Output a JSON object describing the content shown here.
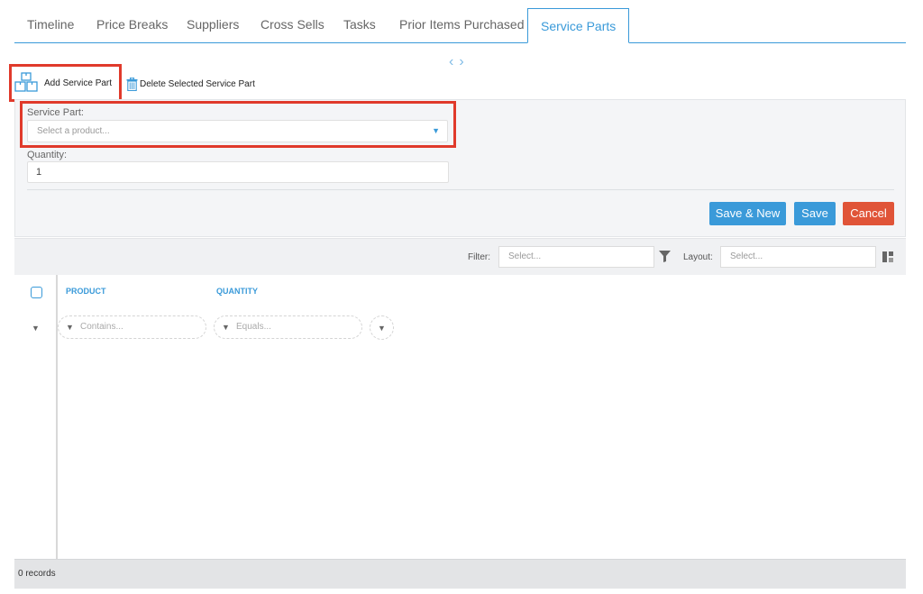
{
  "tabs": [
    {
      "label": "Timeline"
    },
    {
      "label": "Price Breaks"
    },
    {
      "label": "Suppliers"
    },
    {
      "label": "Cross Sells"
    },
    {
      "label": "Tasks"
    },
    {
      "label": "Prior Items Purchased"
    },
    {
      "label": "Service Parts",
      "active": true
    }
  ],
  "carousel": {
    "prev": "‹",
    "next": "›"
  },
  "toolbar": {
    "add_label": "Add Service Part",
    "delete_label": "Delete Selected Service Part"
  },
  "form": {
    "service_part_label": "Service Part:",
    "service_part_placeholder": "Select a product...",
    "quantity_label": "Quantity:",
    "quantity_value": "1",
    "save_new_label": "Save & New",
    "save_label": "Save",
    "cancel_label": "Cancel"
  },
  "filter_bar": {
    "filter_label": "Filter:",
    "filter_placeholder": "Select...",
    "layout_label": "Layout:",
    "layout_placeholder": "Select..."
  },
  "grid": {
    "columns": [
      {
        "header": "PRODUCT",
        "filter_placeholder": "Contains..."
      },
      {
        "header": "QUANTITY",
        "filter_placeholder": "Equals..."
      }
    ]
  },
  "footer": {
    "records": "0 records"
  },
  "colors": {
    "accent": "#3a9ad9",
    "danger": "#e05438",
    "highlight": "#e03a2b"
  }
}
